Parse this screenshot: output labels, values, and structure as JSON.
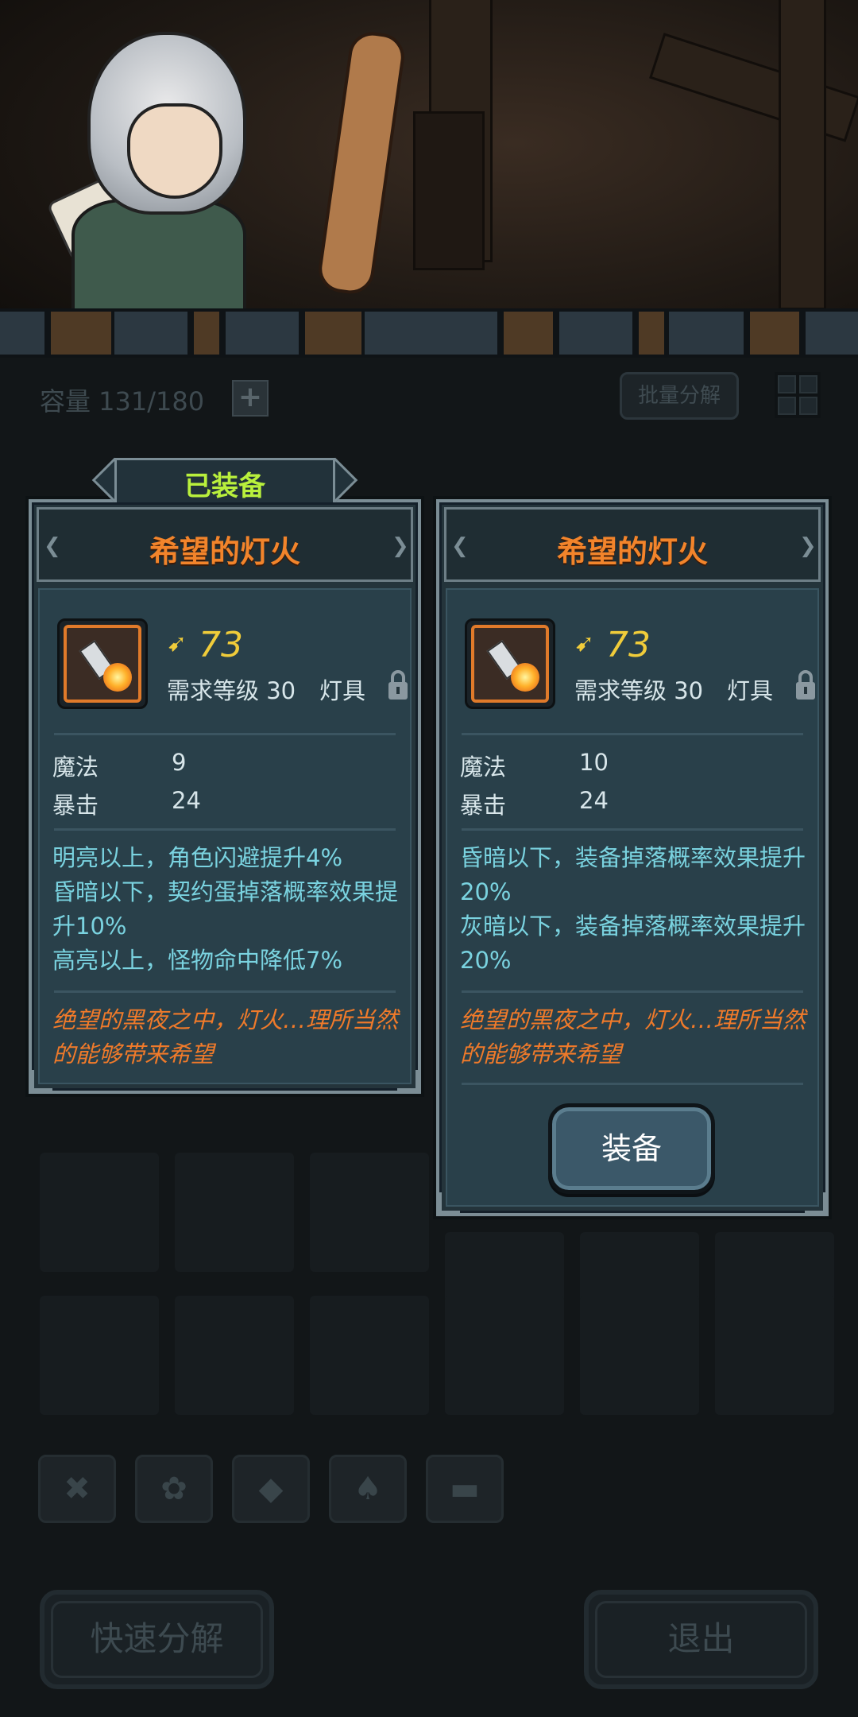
{
  "inventory": {
    "capacity_label": "容量 131/180",
    "add_capacity": "+",
    "bulk_dismantle": "批量分解",
    "categories": [
      "weapon-icon",
      "paw-icon",
      "gem-icon",
      "spade-icon",
      "chest-icon"
    ],
    "quick_dismantle": "快速分解",
    "exit": "退出"
  },
  "equipped_tag": "已装备",
  "equipped_card": {
    "title": "希望的灯火",
    "power": "73",
    "requirement": "需求等级 30",
    "category": "灯具",
    "stats": [
      {
        "name": "魔法",
        "value": "9"
      },
      {
        "name": "暴击",
        "value": "24"
      }
    ],
    "effects": [
      "明亮以上，角色闪避提升4%",
      "昏暗以下，契约蛋掉落概率效果提升10%",
      "高亮以上，怪物命中降低7%"
    ],
    "flavor": "绝望的黑夜之中，灯火…理所当然的能够带来希望"
  },
  "compare_card": {
    "title": "希望的灯火",
    "power": "73",
    "requirement": "需求等级 30",
    "category": "灯具",
    "stats": [
      {
        "name": "魔法",
        "value": "10"
      },
      {
        "name": "暴击",
        "value": "24"
      }
    ],
    "effects": [
      "昏暗以下，装备掉落概率效果提升20%",
      "灰暗以下，装备掉落概率效果提升20%"
    ],
    "flavor": "绝望的黑夜之中，灯火…理所当然的能够带来希望",
    "equip_button": "装备"
  },
  "colors": {
    "title": "#f2842b",
    "equipped_tag": "#b9f03c",
    "effect_text": "#7ad3e0",
    "flavor_text": "#f07a2a",
    "power": "#f0cc3a"
  }
}
